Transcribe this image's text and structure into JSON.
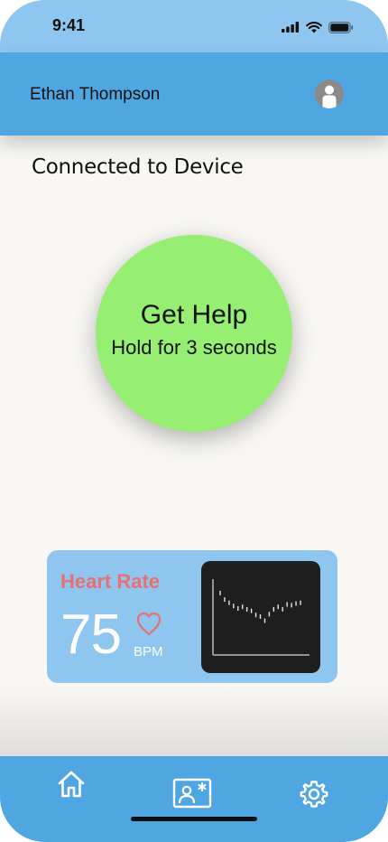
{
  "status_bar": {
    "time": "9:41"
  },
  "header": {
    "user_name": "Ethan Thompson"
  },
  "connection": {
    "status_text": "Connected to Device"
  },
  "help_button": {
    "title": "Get Help",
    "subtitle": "Hold for 3 seconds",
    "color": "#96ef73"
  },
  "heart_rate": {
    "title": "Heart Rate",
    "value": "75",
    "unit": "BPM",
    "title_color": "#ea6f72",
    "trend": [
      34,
      26,
      22,
      18,
      15,
      17,
      14,
      12,
      7,
      5,
      0,
      8,
      14,
      17,
      14,
      20,
      19,
      21,
      22
    ]
  },
  "tab_bar": {
    "items": [
      {
        "icon": "home-icon"
      },
      {
        "icon": "contact-card-icon"
      },
      {
        "icon": "gear-icon"
      }
    ]
  },
  "colors": {
    "status_bar": "#8fc6ef",
    "header": "#4fa6e0",
    "background": "#f8f7f4",
    "card": "#8fc6ef",
    "tab_bar": "#4fa6e0"
  }
}
